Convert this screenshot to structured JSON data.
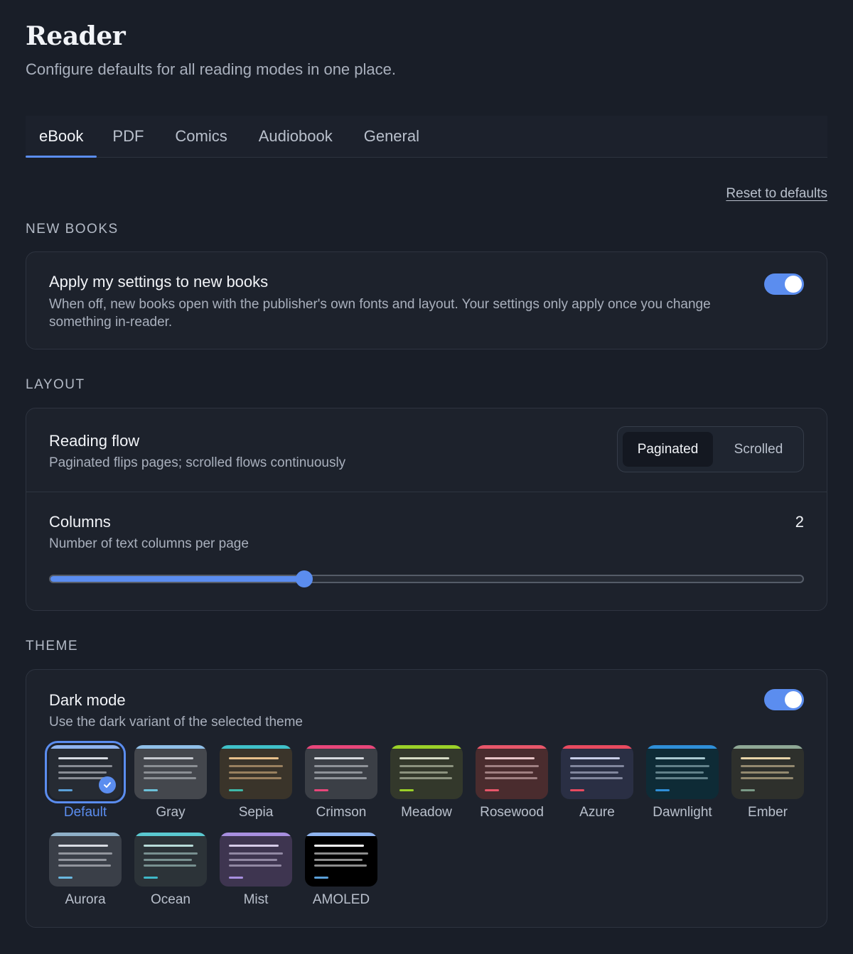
{
  "header": {
    "title": "Reader",
    "subtitle": "Configure defaults for all reading modes in one place."
  },
  "tabs": [
    {
      "label": "eBook",
      "active": true
    },
    {
      "label": "PDF",
      "active": false
    },
    {
      "label": "Comics",
      "active": false
    },
    {
      "label": "Audiobook",
      "active": false
    },
    {
      "label": "General",
      "active": false
    }
  ],
  "reset_label": "Reset to defaults",
  "sections": {
    "new_books": {
      "label": "NEW BOOKS",
      "apply_settings": {
        "title": "Apply my settings to new books",
        "description": "When off, new books open with the publisher's own fonts and layout. Your settings only apply once you change something in-reader.",
        "enabled": true
      }
    },
    "layout": {
      "label": "LAYOUT",
      "reading_flow": {
        "title": "Reading flow",
        "description": "Paginated flips pages; scrolled flows continuously",
        "options": [
          "Paginated",
          "Scrolled"
        ],
        "selected": "Paginated"
      },
      "columns": {
        "title": "Columns",
        "description": "Number of text columns per page",
        "value": "2",
        "slider_fraction": 0.337
      }
    },
    "theme": {
      "label": "THEME",
      "dark_mode": {
        "title": "Dark mode",
        "description": "Use the dark variant of the selected theme",
        "enabled": true
      },
      "themes": [
        {
          "name": "Default",
          "bg": "#262b33",
          "bar": "#8fb4f0",
          "line": "#d8dce3",
          "accent": "#5aa0d8",
          "selected": true
        },
        {
          "name": "Gray",
          "bg": "#44474d",
          "bar": "#8fbfe8",
          "line": "#c7cad0",
          "accent": "#6cc0d8",
          "selected": false
        },
        {
          "name": "Sepia",
          "bg": "#3a342a",
          "bar": "#3fc1c9",
          "line": "#e8c08a",
          "accent": "#3fb8a8",
          "selected": false
        },
        {
          "name": "Crimson",
          "bg": "#3b3f46",
          "bar": "#e8467a",
          "line": "#d6d9de",
          "accent": "#e8467a",
          "selected": false
        },
        {
          "name": "Meadow",
          "bg": "#33382b",
          "bar": "#9bd128",
          "line": "#d6dcc4",
          "accent": "#9bd128",
          "selected": false
        },
        {
          "name": "Rosewood",
          "bg": "#4a2c2e",
          "bar": "#e8566a",
          "line": "#e8c6c8",
          "accent": "#e8566a",
          "selected": false
        },
        {
          "name": "Azure",
          "bg": "#2a2f44",
          "bar": "#e84a5f",
          "line": "#c8cde8",
          "accent": "#e84a5f",
          "selected": false
        },
        {
          "name": "Dawnlight",
          "bg": "#0e2b36",
          "bar": "#2f8fd8",
          "line": "#a8c8d0",
          "accent": "#2f8fd8",
          "selected": false
        },
        {
          "name": "Ember",
          "bg": "#2e302c",
          "bar": "#8fa896",
          "line": "#e8d4a8",
          "accent": "#7a9a86",
          "selected": false
        },
        {
          "name": "Aurora",
          "bg": "#3a3f48",
          "bar": "#8fb0c8",
          "line": "#d8dce3",
          "accent": "#6ab8e0",
          "selected": false
        },
        {
          "name": "Ocean",
          "bg": "#2c3338",
          "bar": "#5ac8d0",
          "line": "#b8dcd8",
          "accent": "#3fb8c8",
          "selected": false
        },
        {
          "name": "Mist",
          "bg": "#3e3550",
          "bar": "#a88fe0",
          "line": "#d6cce8",
          "accent": "#a88fe0",
          "selected": false
        },
        {
          "name": "AMOLED",
          "bg": "#000000",
          "bar": "#8fb4f0",
          "line": "#ffffff",
          "accent": "#5aa0d8",
          "selected": false
        }
      ]
    }
  }
}
